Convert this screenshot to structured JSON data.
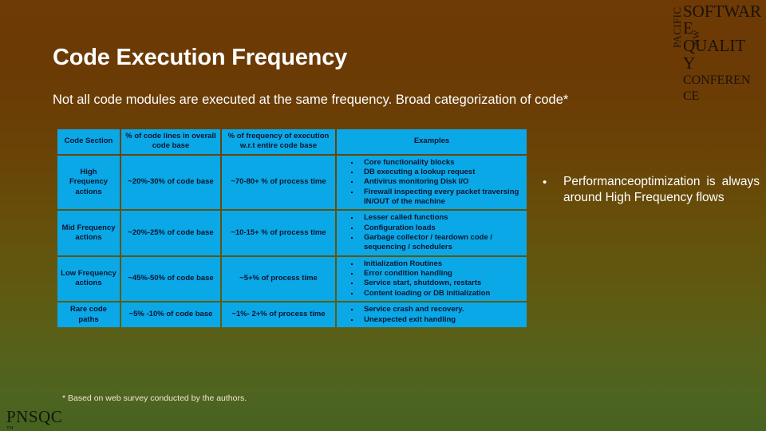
{
  "slide": {
    "title": "Code Execution Frequency",
    "subtitle": "Not all code modules are executed at the same frequency. Broad categorization of code*",
    "footnote": "* Based on web survey conducted by the authors.",
    "background_top_color": "#6e3a05",
    "background_bottom_color": "#47621f",
    "table_cell_color": "#0aa8e6"
  },
  "logo": {
    "vertical_left": "PACIFIC",
    "vertical_inner": "NW",
    "line1": "SOFTWAR",
    "line2": "E",
    "line3": "QUALIT",
    "line4": "Y",
    "line5": "CONFEREN",
    "line6": "CE"
  },
  "brand": {
    "name": "PNSQC",
    "tagline": "™"
  },
  "table": {
    "headers": [
      "Code Section",
      "% of code lines in overall code base",
      "% of frequency of execution w.r.t entire code base",
      "Examples"
    ],
    "rows": [
      {
        "section": "High Frequency actions",
        "code_lines": "~20%-30% of code base",
        "frequency": "~70-80+ % of process time",
        "examples": [
          "Core functionality blocks",
          "DB executing a lookup request",
          "Antivirus monitoring Disk I/O",
          "Firewall inspecting every packet traversing IN/OUT of the machine"
        ]
      },
      {
        "section": "Mid Frequency actions",
        "code_lines": "~20%-25% of code base",
        "frequency": "~10-15+ % of process time",
        "examples": [
          "Lesser called functions",
          "Configuration loads",
          "Garbage collector / teardown code / sequencing / schedulers"
        ]
      },
      {
        "section": "Low Frequency actions",
        "code_lines": "~45%-50% of code base",
        "frequency": "~5+% of process time",
        "examples": [
          "Initialization Routines",
          "Error condition handling",
          "Service start, shutdown, restarts",
          "Content loading or DB initialization"
        ]
      },
      {
        "section": "Rare code paths",
        "code_lines": "~5% -10% of code base",
        "frequency": "~1%- 2+% of process time",
        "examples": [
          "Service crash and recovery.",
          "Unexpected exit handling"
        ]
      }
    ]
  },
  "side_note": {
    "bullet_glyph": "•",
    "text": "Performanceoptimization is always around High Frequency flows"
  }
}
